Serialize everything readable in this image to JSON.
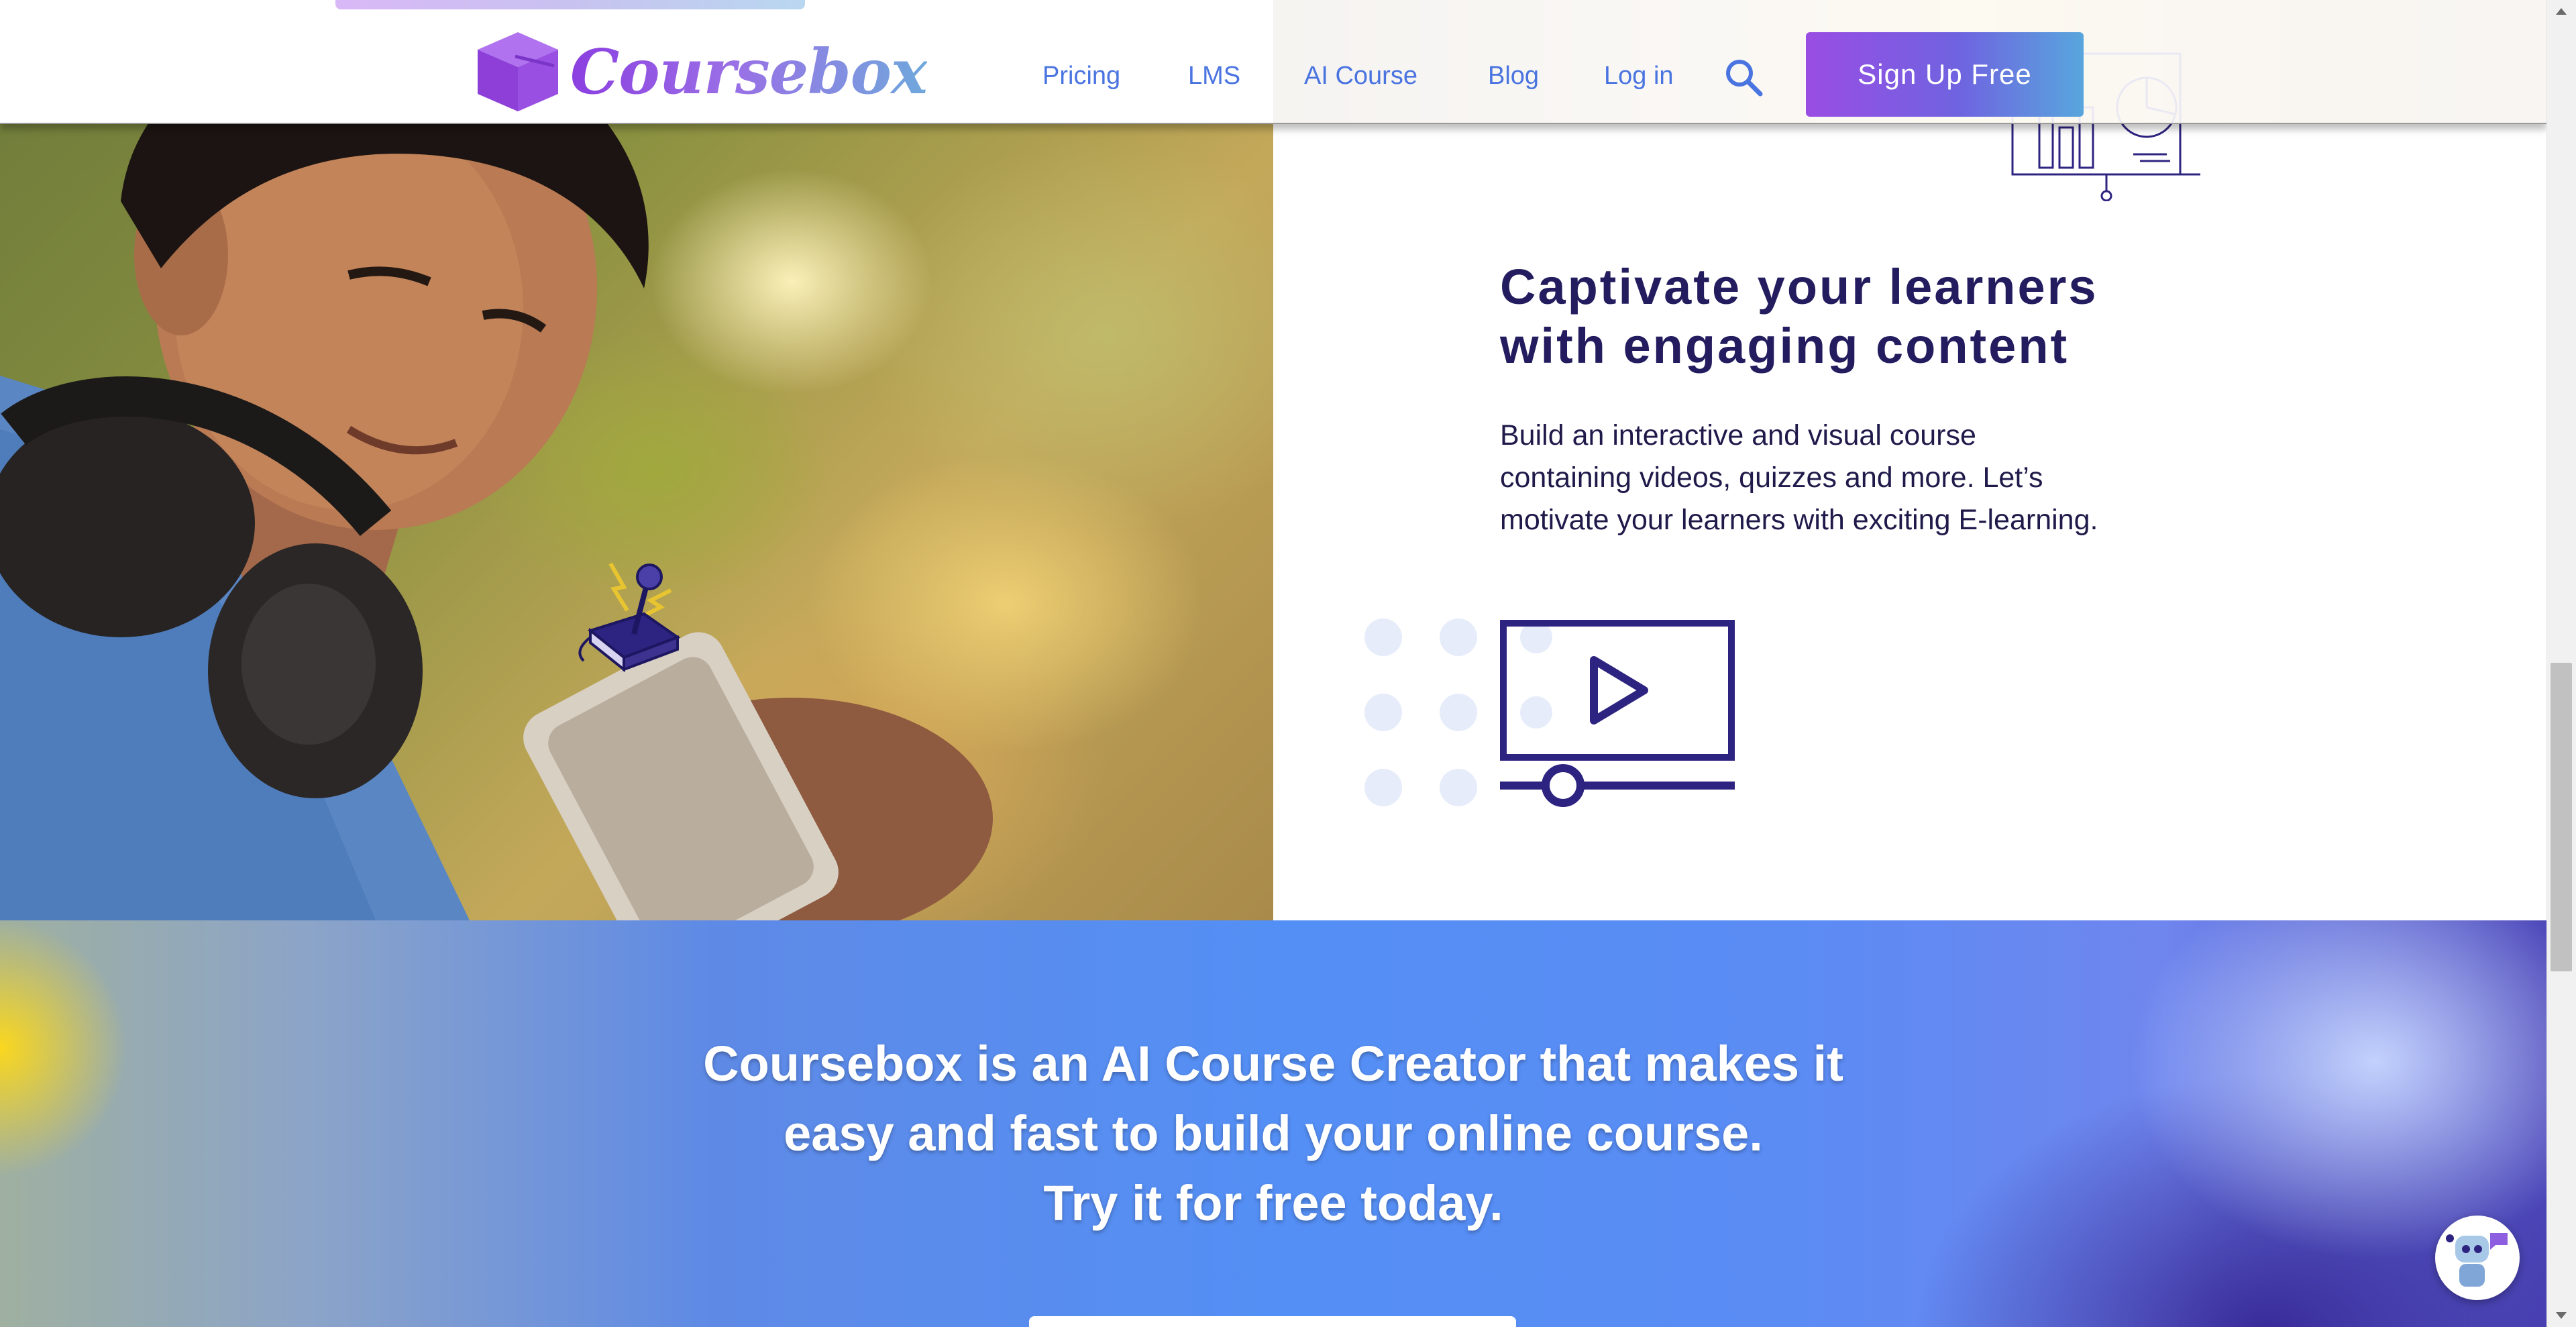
{
  "header": {
    "logo_text": "Coursebox",
    "nav": [
      {
        "label": "Pricing"
      },
      {
        "label": "LMS"
      },
      {
        "label": "AI Course"
      },
      {
        "label": "Blog"
      },
      {
        "label": "Log in"
      }
    ],
    "signup_label": "Sign Up Free"
  },
  "feature": {
    "title_line1": "Captivate your learners",
    "title_line2": "with engaging content",
    "body_line1": "Build an interactive and visual course",
    "body_line2": "containing videos, quizzes and more. Let’s",
    "body_line3": "motivate your learners with exciting E-learning."
  },
  "cta": {
    "line1": "Coursebox is an AI Course Creator that makes it",
    "line2": "easy and fast to build your online course.",
    "line3": "Try it for free today."
  },
  "icons": [
    "coursebox-logo-icon",
    "search-icon",
    "joystick-icon",
    "video-play-icon",
    "chart-board-icon",
    "chatbot-icon"
  ],
  "colors": {
    "brand_purple": "#8b3fe0",
    "nav_blue": "#4a74e0",
    "heading_navy": "#231c5e",
    "cta_blue": "#548ff5"
  }
}
